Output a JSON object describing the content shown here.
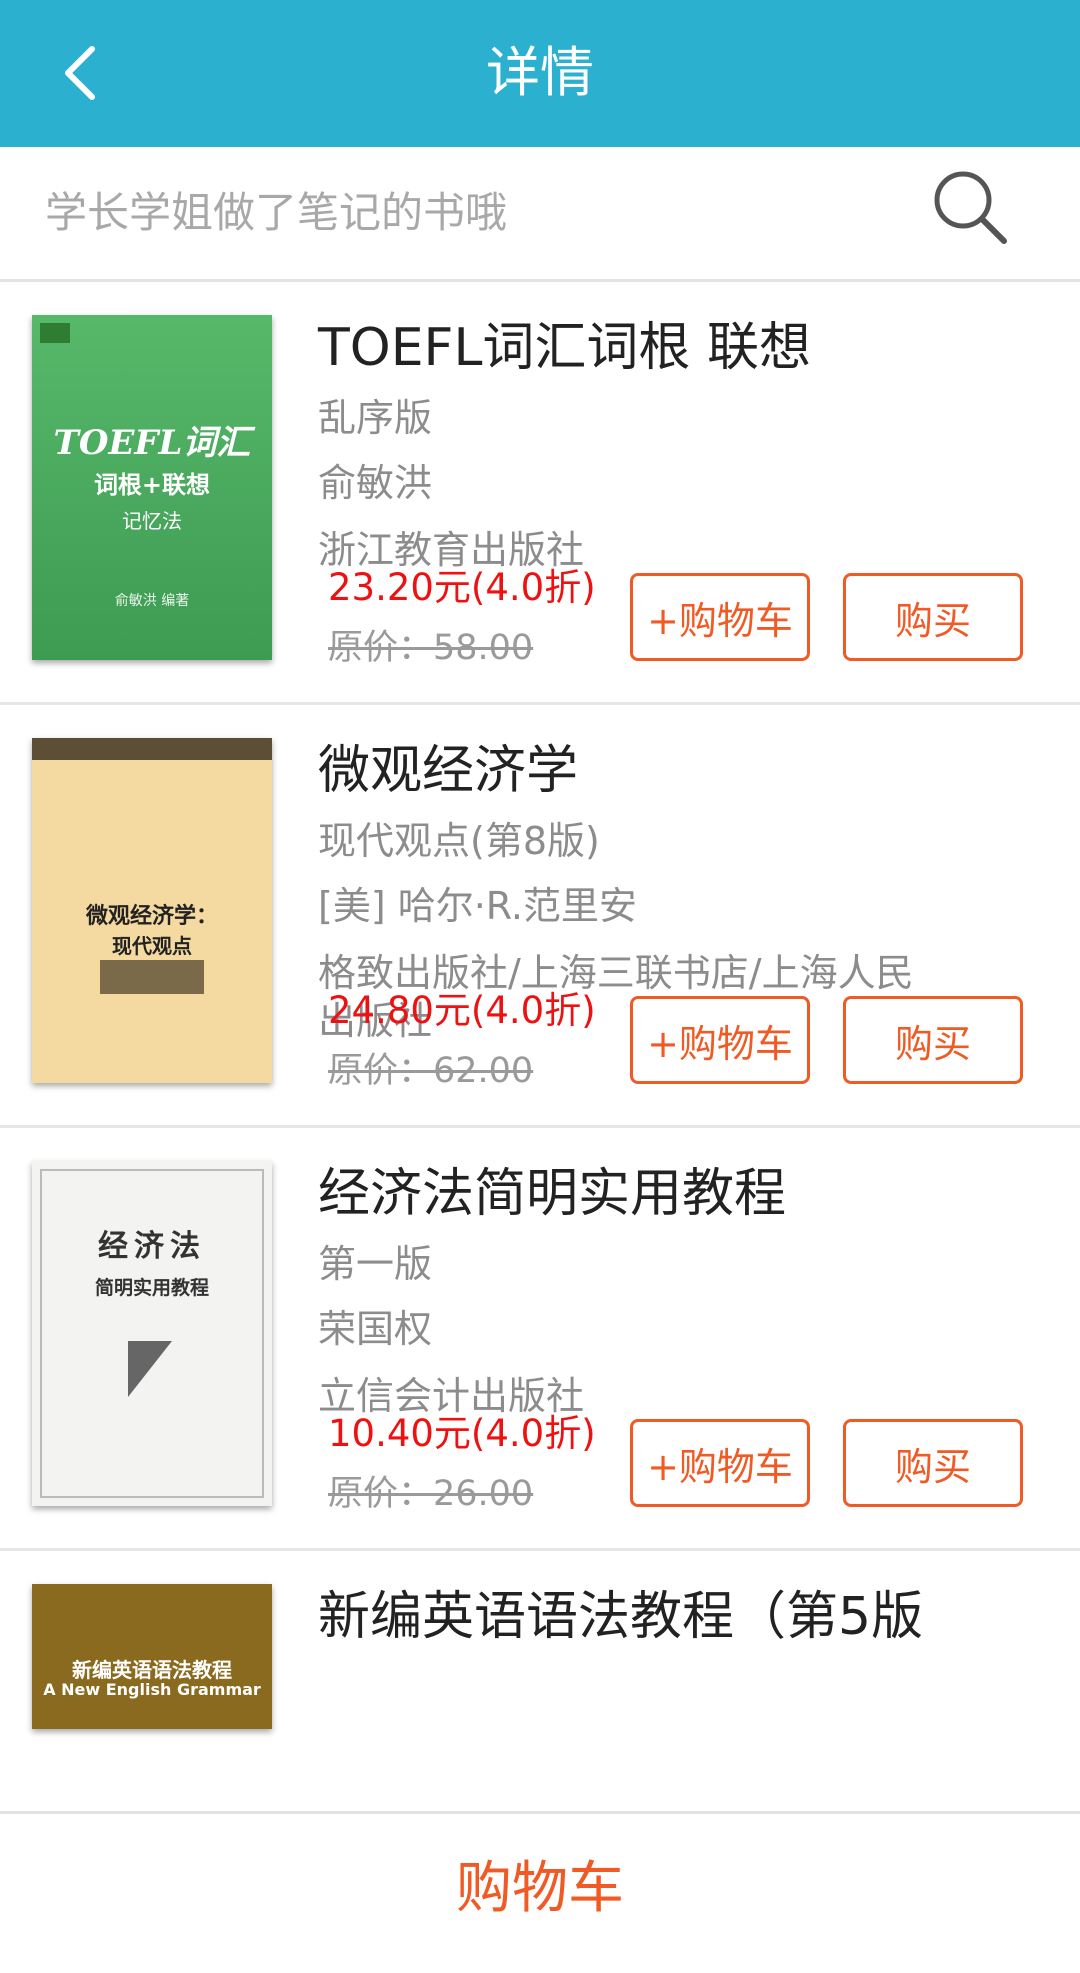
{
  "header": {
    "title": "详情",
    "back_icon": "back-arrow-icon"
  },
  "search": {
    "placeholder": "学长学姐做了笔记的书哦",
    "icon": "search-icon"
  },
  "books": [
    {
      "title": "TOEFL词汇词根 联想",
      "subtitle": "乱序版",
      "author": "俞敏洪",
      "publisher": "浙江教育出版社",
      "price": "23.20元(4.0折)",
      "original_price": "原价：58.00",
      "cart_label": "+购物车",
      "buy_label": "购买",
      "cover": {
        "style": "green",
        "line1": "TOEFL词汇",
        "line2": "词根+联想",
        "line3": "记忆法",
        "author": "俞敏洪 编著"
      }
    },
    {
      "title": "微观经济学",
      "subtitle": "现代观点(第8版)",
      "author": "[美] 哈尔·R.范里安",
      "publisher": "格致出版社/上海三联书店/上海人民出版社",
      "price": "24.80元(4.0折)",
      "original_price": "原价：62.00",
      "cart_label": "+购物车",
      "buy_label": "购买",
      "cover": {
        "style": "tan",
        "line1": "微观经济学：",
        "line2": "现代观点"
      }
    },
    {
      "title": "经济法简明实用教程",
      "subtitle": "第一版",
      "author": "荣国权",
      "publisher": "立信会计出版社",
      "price": "10.40元(4.0折)",
      "original_price": "原价：26.00",
      "cart_label": "+购物车",
      "buy_label": "购买",
      "cover": {
        "style": "white",
        "line1": "经济法",
        "line2": "简明实用教程"
      }
    },
    {
      "title": "新编英语语法教程（第5版",
      "cover": {
        "style": "brown",
        "line1": "新编英语语法教程",
        "line2": "A New English Grammar"
      }
    }
  ],
  "footer": {
    "cart_label": "购物车"
  },
  "colors": {
    "header": "#2bb0cf",
    "accent": "#f05a24",
    "price": "#ee1111"
  }
}
